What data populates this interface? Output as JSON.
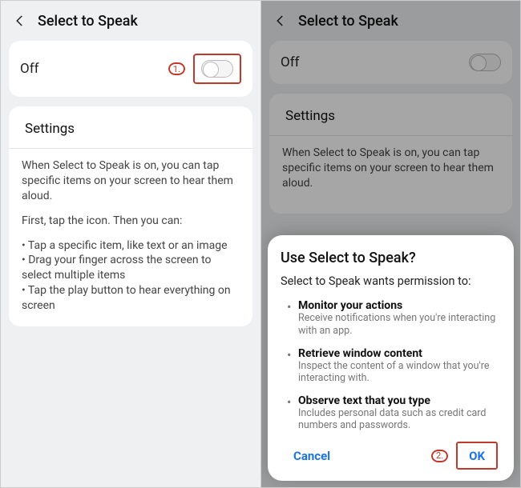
{
  "left": {
    "header": {
      "title": "Select to Speak"
    },
    "toggle": {
      "label": "Off",
      "annot": "1."
    },
    "settings": {
      "title": "Settings",
      "intro": "When Select to Speak is on, you can tap specific items on your screen to hear them aloud.",
      "lead": "First, tap the icon. Then you can:",
      "bullets": [
        "• Tap a specific item, like text or an image",
        "• Drag your finger across the screen to select multiple items",
        "• Tap the play button to hear everything on screen"
      ]
    }
  },
  "right": {
    "header": {
      "title": "Select to Speak"
    },
    "toggle": {
      "label": "Off"
    },
    "settings": {
      "title": "Settings",
      "intro": "When Select to Speak is on, you can tap specific items on your screen to hear them aloud."
    },
    "dialog": {
      "title": "Use Select to Speak?",
      "subtitle": "Select to Speak wants permission to:",
      "perms": [
        {
          "name": "Monitor your actions",
          "desc": "Receive notifications when you're interacting with an app."
        },
        {
          "name": "Retrieve window content",
          "desc": "Inspect the content of a window that you're interacting with."
        },
        {
          "name": "Observe text that you type",
          "desc": "Includes personal data such as credit card numbers and passwords."
        }
      ],
      "cancel": "Cancel",
      "annot": "2.",
      "ok": "OK"
    }
  }
}
